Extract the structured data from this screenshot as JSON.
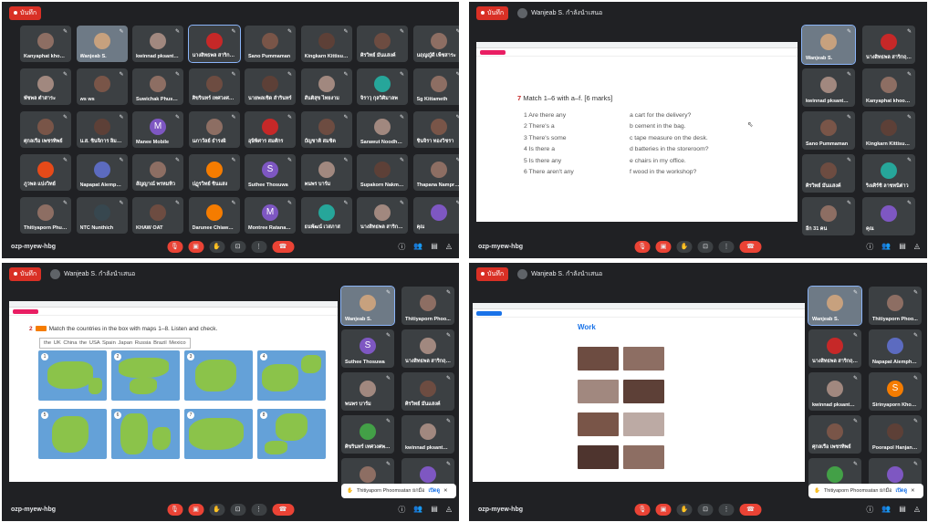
{
  "pane1": {
    "rec_label": "บันทึก",
    "meet_code": "ozp-myew-hbg",
    "tiles": [
      {
        "name": "Kanyaphat khoon...",
        "color": "#8d6e63"
      },
      {
        "name": "Wanjeab S.",
        "color": "#c7a17e"
      },
      {
        "name": "kwinnad pksanthe...",
        "color": "#a1887f"
      },
      {
        "name": "นางสิทธพล สาริกฤกษ์",
        "color": "#c62828"
      },
      {
        "name": "Sano Pummaman",
        "color": "#795548"
      },
      {
        "name": "Kingkarn Kittisunt...",
        "color": "#5d4037"
      },
      {
        "name": "ศิรวิทย์ มั่นแสงค์",
        "color": "#6d4c41"
      },
      {
        "name": "นฤญญ์ดี เพ็ชสาระ",
        "color": "#8d6e63"
      },
      {
        "name": "พัชพล ตำสาระ",
        "color": "#a1887f"
      },
      {
        "name": "ws ws",
        "color": "#795548"
      },
      {
        "name": "Suwichak Phusoo...",
        "color": "#8d6e63"
      },
      {
        "name": "ศิขรินทร์ เทศวงศพนต์",
        "color": "#6d4c41"
      },
      {
        "name": "นายพลเชิด สำรินทร์",
        "color": "#5d4037"
      },
      {
        "name": "สันติสุข ไทยงาม",
        "color": "#a1887f"
      },
      {
        "name": "จิราวุ กุลวิศิมาลพ",
        "color": "#26a69a"
      },
      {
        "name": "Sg Kittameth",
        "color": "#8d6e63"
      },
      {
        "name": "ศุกลเรือ เพชรทิพย์",
        "color": "#795548"
      },
      {
        "name": "น.ส. ชินจิการ ลิ่มตระนั...",
        "color": "#5d4037"
      },
      {
        "name": "Manee Mobile",
        "color": "#7e57c2",
        "letter": "M"
      },
      {
        "name": "นภาวัลย์ ธำรงผิ",
        "color": "#8d6e63"
      },
      {
        "name": "อุษิพิศาร สมศักร",
        "color": "#c62828"
      },
      {
        "name": "บัญชาติ สมชิต",
        "color": "#6d4c41"
      },
      {
        "name": "Sarawut Noodham",
        "color": "#a1887f"
      },
      {
        "name": "ชินจิรา ทองวิชรา",
        "color": "#795548"
      },
      {
        "name": "ภูวพล แปงวิทย์",
        "color": "#e64a19"
      },
      {
        "name": "Napapat Aiemphe...",
        "color": "#5c6bc0"
      },
      {
        "name": "สัญญาณ์ พรหมทิว",
        "color": "#8d6e63"
      },
      {
        "name": "ปฏุรวิทย์ ชินแสง",
        "color": "#f57c00"
      },
      {
        "name": "Suthee Thosuwa",
        "color": "#7e57c2",
        "letter": "S"
      },
      {
        "name": "พนพร บาร์ม",
        "color": "#a1887f"
      },
      {
        "name": "Supakorn Nakmon...",
        "color": "#5d4037"
      },
      {
        "name": "Thapana Nampradit",
        "color": "#8d6e63"
      },
      {
        "name": "Thitiyaporn Phus...",
        "color": "#8d6e63"
      },
      {
        "name": "NTC Nunthich",
        "color": "#37474f"
      },
      {
        "name": "KHAW OAT",
        "color": "#6d4c41"
      },
      {
        "name": "Darunee Chiawda...",
        "color": "#f57c00"
      },
      {
        "name": "Montree Ratanaku...",
        "color": "#7e57c2",
        "letter": "M"
      },
      {
        "name": "ธนพัฒน์ เวสภาส",
        "color": "#26a69a"
      },
      {
        "name": "นางสิทธพล สาริกฤกษ์",
        "color": "#a1887f"
      },
      {
        "name": "คุณ",
        "color": "#7e57c2"
      }
    ]
  },
  "pane2": {
    "rec_label": "บันทึก",
    "presenter": "Wanjeab S. กำลังนำเสนอ",
    "meet_code": "ozp-myew-hbg",
    "exercise_num": "7",
    "exercise_title": "Match 1–6 with a–f. [6 marks]",
    "left_items": [
      "1  Are there any",
      "2  There's a",
      "3  There's some",
      "4  Is there a",
      "5  Is there any",
      "6  There aren't any"
    ],
    "right_items": [
      "a  cart for the delivery?",
      "b  cement in the bag.",
      "c  tape measure on the desk.",
      "d  batteries in the storeroom?",
      "e  chairs in my office.",
      "f  wood in the workshop?"
    ],
    "side_tiles": [
      {
        "name": "Wanjeab S.",
        "color": "#c7a17e"
      },
      {
        "name": "นางสิทธพล สาริกฤกษ์",
        "color": "#c62828"
      },
      {
        "name": "kwinnad pksanthwin",
        "color": "#a1887f"
      },
      {
        "name": "Kanyaphat khoonkh...",
        "color": "#8d6e63"
      },
      {
        "name": "Sano Pummaman",
        "color": "#795548"
      },
      {
        "name": "Kingkarn Kittisuntar...",
        "color": "#5d4037"
      },
      {
        "name": "ศิรวิทย์ มั่นแสงค์",
        "color": "#6d4c41"
      },
      {
        "name": "ริงเศิร์ชิ ลาชทนิต่าว",
        "color": "#26a69a"
      },
      {
        "name": "อีก 31 คน",
        "color": "#8d6e63"
      },
      {
        "name": "คุณ",
        "color": "#7e57c2"
      }
    ]
  },
  "pane3": {
    "rec_label": "บันทึก",
    "presenter": "Wanjeab S. กำลังนำเสนอ",
    "meet_code": "ozp-myew-hbg",
    "exercise_num": "2",
    "instruction": "Match the countries in the box with maps 1–8. Listen and check.",
    "countries": "the UK  China  the USA  Spain  Japan  Russia  Brazil  Mexico",
    "map_numbers": [
      "1",
      "2",
      "3",
      "4",
      "5",
      "6",
      "7",
      "8"
    ],
    "side_tiles": [
      {
        "name": "Wanjeab S.",
        "color": "#c7a17e"
      },
      {
        "name": "Thitiyaporn Phoo...",
        "color": "#8d6e63"
      },
      {
        "name": "Suthee Thosuwa",
        "color": "#7e57c2",
        "letter": "S"
      },
      {
        "name": "นางสิทธพล สาริกฤกษ์",
        "color": "#a1887f"
      },
      {
        "name": "พนพร บาร์ม",
        "color": "#a1887f"
      },
      {
        "name": "ศิรวิทย์ มั่นแสงค์",
        "color": "#6d4c41"
      },
      {
        "name": "ศิขรินทร์ เทศวงศพนต์",
        "color": "#43a047"
      },
      {
        "name": "kwinnad pksanthwin",
        "color": "#a1887f"
      },
      {
        "name": "",
        "color": "#8d6e63"
      },
      {
        "name": "",
        "color": "#7e57c2"
      }
    ],
    "notification": "Thitiyaporn Phoomsatan ยกมือ",
    "notif_action": "เปิดดู"
  },
  "pane4": {
    "rec_label": "บันทึก",
    "presenter": "Wanjeab S. กำลังนำเสนอ",
    "meet_code": "ozp-myew-hbg",
    "work_title": "Work",
    "side_tiles": [
      {
        "name": "Wanjeab S.",
        "color": "#c7a17e"
      },
      {
        "name": "Thitiyaporn Phoo...",
        "color": "#8d6e63"
      },
      {
        "name": "นางสิทธพล สาริกฤกษ์",
        "color": "#c62828"
      },
      {
        "name": "Napapat Aiemphaye",
        "color": "#5c6bc0"
      },
      {
        "name": "kwinnad pksanthwin",
        "color": "#a1887f"
      },
      {
        "name": "Sirinyaporn Khonnu",
        "color": "#f57c00",
        "letter": "S"
      },
      {
        "name": "ศุกลเรือ เพชรทิพย์",
        "color": "#795548"
      },
      {
        "name": "Poorapol Hanjan-ad",
        "color": "#5d4037"
      },
      {
        "name": "",
        "color": "#43a047"
      },
      {
        "name": "",
        "color": "#7e57c2"
      }
    ],
    "notification": "Thitiyaporn Phoomsatan ยกมือ",
    "notif_action": "เปิดดู"
  }
}
